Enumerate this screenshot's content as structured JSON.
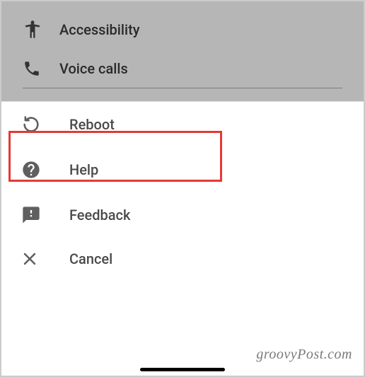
{
  "background": {
    "items": [
      {
        "label": "Accessibility",
        "icon": "accessibility-icon"
      },
      {
        "label": "Voice calls",
        "icon": "phone-icon"
      }
    ]
  },
  "sheet": {
    "items": [
      {
        "label": "Reboot",
        "icon": "refresh-icon"
      },
      {
        "label": "Help",
        "icon": "help-icon"
      },
      {
        "label": "Feedback",
        "icon": "feedback-icon"
      },
      {
        "label": "Cancel",
        "icon": "close-icon"
      }
    ]
  },
  "watermark": "groovyPost.com"
}
